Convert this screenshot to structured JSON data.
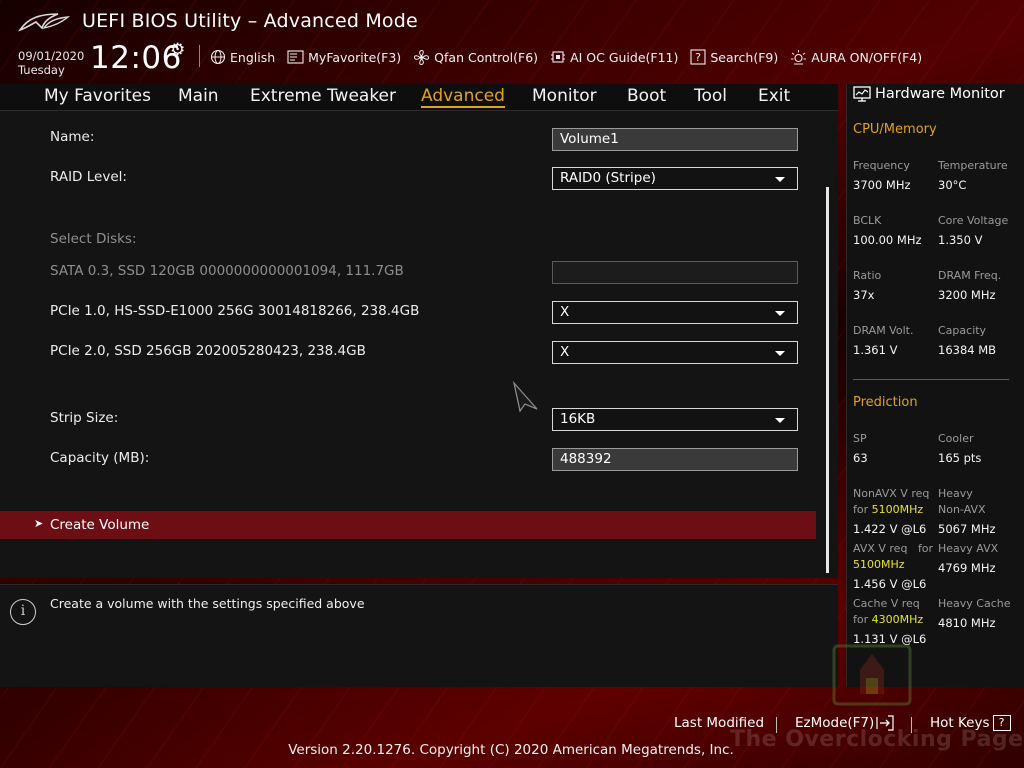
{
  "header": {
    "app_title": "UEFI BIOS Utility – Advanced Mode",
    "date": "09/01/2020",
    "day": "Tuesday",
    "time": "12:06",
    "toolbar": [
      {
        "label": "English",
        "icon": "globe-icon"
      },
      {
        "label": "MyFavorite(F3)",
        "icon": "favorite-icon"
      },
      {
        "label": "Qfan Control(F6)",
        "icon": "fan-icon"
      },
      {
        "label": "AI OC Guide(F11)",
        "icon": "chip-icon"
      },
      {
        "label": "Search(F9)",
        "icon": "search-question-icon"
      },
      {
        "label": "AURA ON/OFF(F4)",
        "icon": "aura-light-icon"
      }
    ]
  },
  "menu": {
    "items": [
      "My Favorites",
      "Main",
      "Extreme Tweaker",
      "Advanced",
      "Monitor",
      "Boot",
      "Tool",
      "Exit"
    ],
    "active": "Advanced"
  },
  "form": {
    "name_label": "Name:",
    "name_value": "Volume1",
    "raid_label": "RAID Level:",
    "raid_value": "RAID0 (Stripe)",
    "select_disks_label": "Select Disks:",
    "disk1_label": "SATA 0.3, SSD 120GB 0000000000001094, 111.7GB",
    "disk1_value": "",
    "disk2_label": "PCIe 1.0, HS-SSD-E1000 256G 30014818266, 238.4GB",
    "disk2_value": "X",
    "disk3_label": "PCIe 2.0, SSD 256GB 202005280423, 238.4GB",
    "disk3_value": "X",
    "strip_label": "Strip Size:",
    "strip_value": "16KB",
    "capacity_label": "Capacity (MB):",
    "capacity_value": "488392",
    "create_label": "Create Volume"
  },
  "help": {
    "text": "Create a volume with the settings specified above"
  },
  "hw_monitor": {
    "title": "Hardware Monitor",
    "cpu_memory_title": "CPU/Memory",
    "frequency_label": "Frequency",
    "frequency_value": "3700 MHz",
    "temperature_label": "Temperature",
    "temperature_value": "30°C",
    "bclk_label": "BCLK",
    "bclk_value": "100.00 MHz",
    "core_voltage_label": "Core Voltage",
    "core_voltage_value": "1.350 V",
    "ratio_label": "Ratio",
    "ratio_value": "37x",
    "dram_freq_label": "DRAM Freq.",
    "dram_freq_value": "3200 MHz",
    "dram_volt_label": "DRAM Volt.",
    "dram_volt_value": "1.361 V",
    "capacity_label": "Capacity",
    "capacity_value": "16384 MB",
    "prediction_title": "Prediction",
    "sp_label": "SP",
    "sp_value": "63",
    "cooler_label": "Cooler",
    "cooler_value": "165 pts",
    "nonavx_req_label": "NonAVX V req",
    "for_label": "for",
    "nonavx_freq": "5100MHz",
    "nonavx_volt": "1.422 V @L6",
    "heavy_label": "Heavy",
    "nonavx_label": "Non-AVX",
    "heavy_nonavx_value": "5067 MHz",
    "avx_req_label": "AVX V req",
    "avx_for_label": "for",
    "avx_freq": "5100MHz",
    "avx_volt": "1.456 V @L6",
    "heavy_avx_label": "Heavy AVX",
    "heavy_avx_value": "4769 MHz",
    "cache_req_label": "Cache V req",
    "cache_for_label": "for",
    "cache_freq": "4300MHz",
    "cache_volt": "1.131 V @L6",
    "heavy_cache_label": "Heavy Cache",
    "heavy_cache_value": "4810 MHz"
  },
  "footer": {
    "last_modified": "Last Modified",
    "ezmode": "EzMode(F7)",
    "ezmode_icon": "exit-arrow-icon",
    "hotkeys": "Hot Keys",
    "hotkeys_key": "?",
    "version": "Version 2.20.1276. Copyright (C) 2020 American Megatrends, Inc.",
    "watermark": "The Overclocking Page"
  },
  "colors": {
    "accent": "#e0a21f",
    "highlight_row": "#6d0e14",
    "prediction_freq": "#e6e23a"
  }
}
